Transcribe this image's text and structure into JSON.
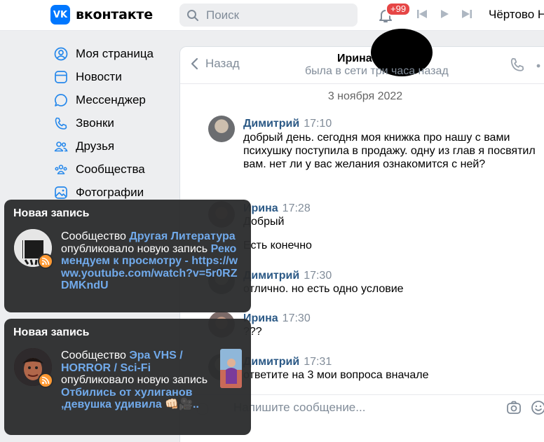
{
  "header": {
    "logo_mark": "VK",
    "logo_text": "вконтакте",
    "search_placeholder": "Поиск",
    "notif_badge": "+99",
    "track_title": "Чёртово Н"
  },
  "sidebar": {
    "items": [
      {
        "label": "Моя страница",
        "icon": "user-circle-icon"
      },
      {
        "label": "Новости",
        "icon": "news-icon"
      },
      {
        "label": "Мессенджер",
        "icon": "message-icon"
      },
      {
        "label": "Звонки",
        "icon": "phone-icon"
      },
      {
        "label": "Друзья",
        "icon": "friends-icon"
      },
      {
        "label": "Сообщества",
        "icon": "communities-icon"
      },
      {
        "label": "Фотографии",
        "icon": "photo-icon"
      }
    ]
  },
  "chat": {
    "back_label": "Назад",
    "peer_name": "Ирина",
    "peer_status": "была в сети три часа назад",
    "date_separator": "3 ноября 2022",
    "messages": [
      {
        "author": "Димитрий",
        "time": "17:10",
        "text": "добрый день. сегодня моя книжка про нашу с вами психушку поступила в продажу. одну из глав я посвятил вам. нет ли у вас желания ознакомится с ней?"
      },
      {
        "author": "Ирина",
        "time": "17:28",
        "text": "Добрый"
      },
      {
        "author": "",
        "time": "",
        "text": "Есть конечно"
      },
      {
        "author": "Димитрий",
        "time": "17:30",
        "text": "отлично. но есть одно условие"
      },
      {
        "author": "Ирина",
        "time": "17:30",
        "text": "???"
      },
      {
        "author": "Димитрий",
        "time": "17:31",
        "text": "ответите на 3 мои вопроса вначале"
      }
    ],
    "composer_placeholder": "Напишите сообщение..."
  },
  "notifications": [
    {
      "title": "Новая запись",
      "prefix": "Сообщество ",
      "community": "Другая Литература",
      "middle": " опубликовало новую запись ",
      "post": "Рекомендуем к просмотру - https://www.youtube.com/watch?v=5r0RZDMKndU"
    },
    {
      "title": "Новая запись",
      "prefix": "Сообщество ",
      "community": "Эра VHS / HORROR / Sci-Fi",
      "middle": " опубликовало новую запись ",
      "post": "Отбились от хулиганов ,девушка удивила 👊🏻🎥.."
    }
  ],
  "colors": {
    "brand": "#0077ff",
    "link": "#2a5885",
    "notif_link": "#71aaeb",
    "badge": "#e64646"
  }
}
